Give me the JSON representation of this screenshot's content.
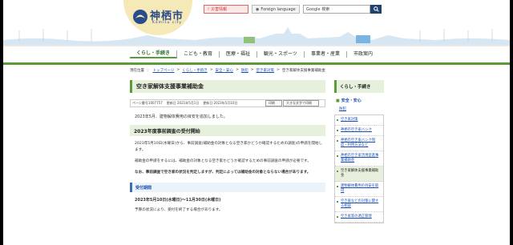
{
  "header": {
    "logo_text": "神栖市",
    "logo_sub": "Kamisu city",
    "disaster_label": "災害情報",
    "language_label": "Foreign language",
    "search_placeholder": "Google 検索"
  },
  "nav": {
    "items": [
      "くらし・手続き",
      "こども・教育",
      "医療・福祉",
      "観光・スポーツ",
      "事業者・産業",
      "市政案内"
    ]
  },
  "breadcrumb": {
    "label": "現在位置",
    "items": [
      "トップページ",
      "くらし・手続き",
      "安全・安心",
      "防犯",
      "空き家対策",
      "空き家解体支援事業補助金"
    ]
  },
  "main": {
    "title": "空き家解体支援事業補助金",
    "page_id": "ページ番号1007757",
    "published": "更新日 2021年5月1日",
    "updated": "更新日 2023年5月10日",
    "print_label": "印刷",
    "print_large_label": "大きな文字で印刷",
    "notice": "2023年5月、建物解体費用の目安を追加しました。",
    "section_title": "2023年度事前調査の受付開始",
    "paragraphs": [
      "2023年5月10日(水曜日)から、事前調査(補助金の対象となる空き家かどうか確認するための調査)の申請を開始します。",
      "補助金の申請をするには、補助金の対象となる空き家かどうか確認するための事前調査の申請が必要です。",
      "なお、事前調査で空き家の状況を判定しますが、判定によっては補助金の対象とならない場合があります。"
    ],
    "period_heading": "受付期間",
    "period": "2023年5月10日(水曜日)～11月30日(木曜日)",
    "period_note": "予算の状況により、受付を終了する場合があります。"
  },
  "sidebar": {
    "heading": "くらし・手続き",
    "section": "安全・安心",
    "sub": "防犯",
    "items": [
      "空き家対策",
      "神栖市空き家バンク",
      "神栖市空き家バンク制度・利用方法など",
      "神栖市空き家活用促進事業補助金",
      "空き家解体支援事業補助金",
      "建物解体費用の目安を取得",
      "空き家などの対策に関する相談",
      "空き家等の適正管理"
    ],
    "current_index": 4
  },
  "colors": {
    "accent_green": "#5a9b3a",
    "link_blue": "#1a4fb0",
    "header_navy": "#20416e"
  }
}
